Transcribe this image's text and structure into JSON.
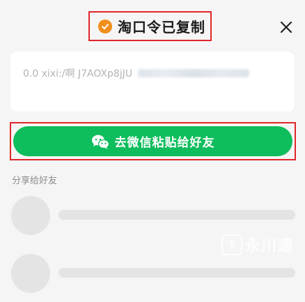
{
  "header": {
    "title": "淘口令已复制",
    "check_icon": "check-circle-icon",
    "close_icon": "close-icon",
    "accent_color": "#f08f1a"
  },
  "token": {
    "text": "0.0 xixi:/啊 J7AOXp8jJU"
  },
  "share_button": {
    "label": "去微信粘贴给好友",
    "icon": "wechat-icon",
    "color": "#0ebd5c"
  },
  "friends_section": {
    "label": "分享给好友"
  },
  "watermark": {
    "badge": "T",
    "text": "永川通"
  }
}
